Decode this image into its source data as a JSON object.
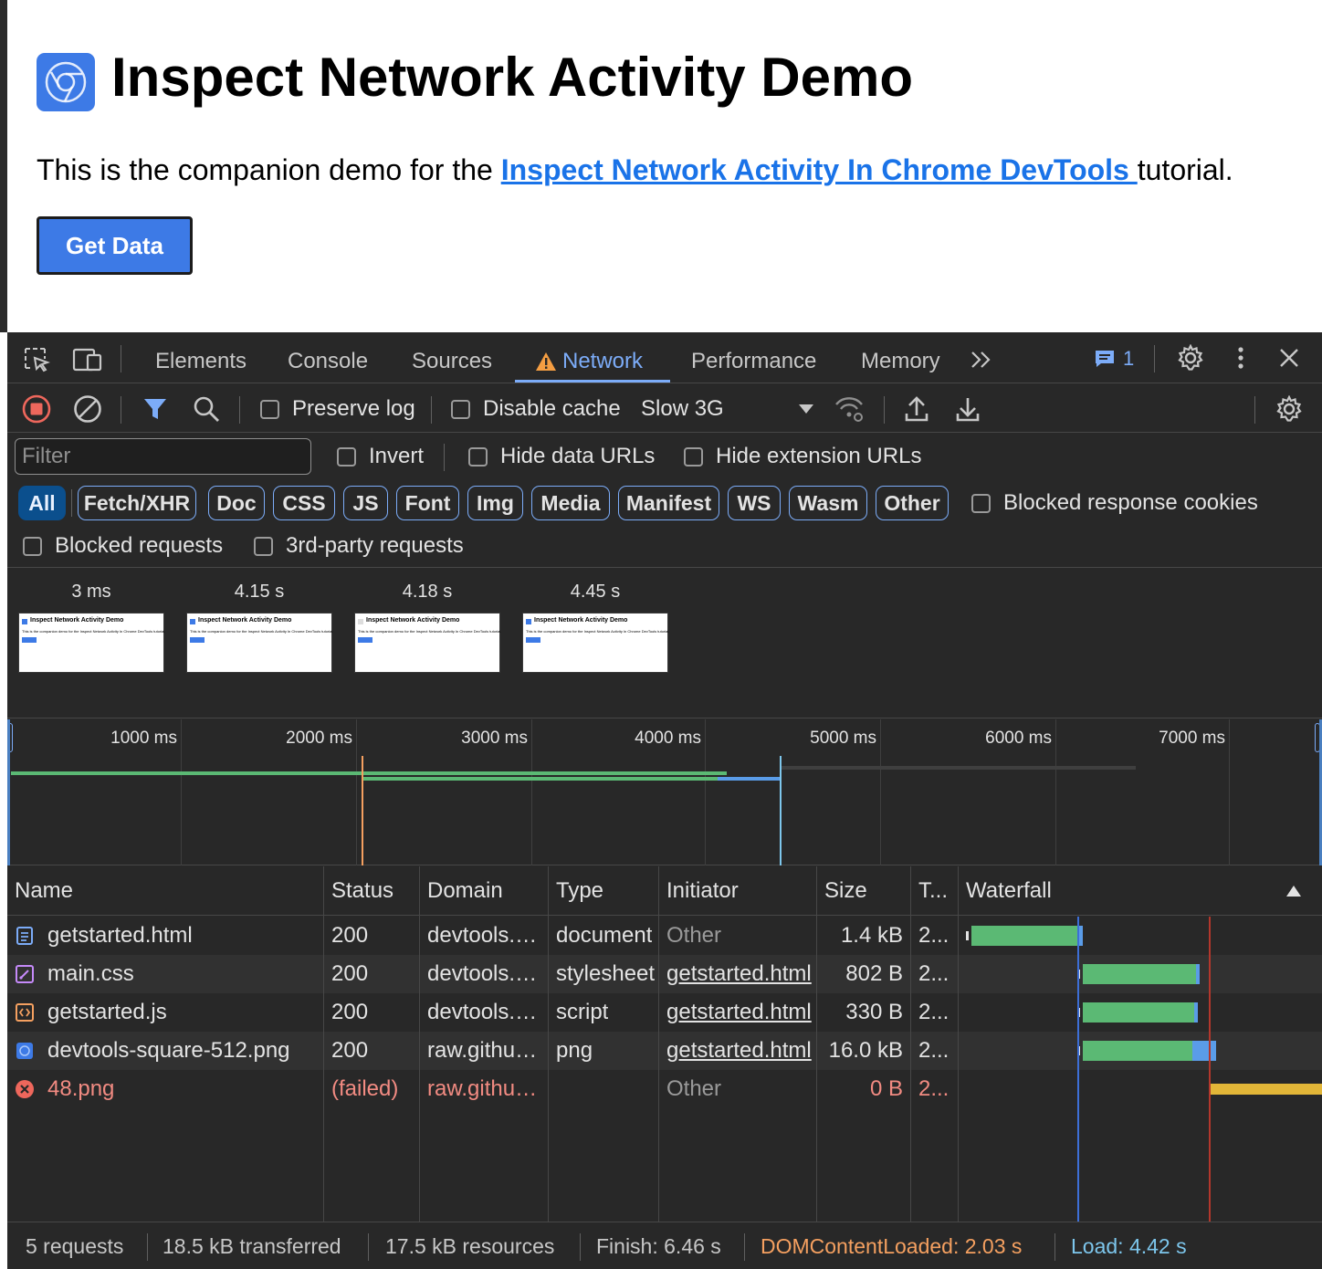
{
  "page": {
    "title": "Inspect Network Activity Demo",
    "text_before": "This is the companion demo for the ",
    "link_text": "Inspect Network Activity In Chrome DevTools ",
    "text_after": "tutorial.",
    "button_label": "Get Data"
  },
  "devtools": {
    "tabs": [
      "Elements",
      "Console",
      "Sources",
      "Network",
      "Performance",
      "Memory"
    ],
    "active_tab": "Network",
    "issues_count": "1",
    "toolbar": {
      "preserve_log": "Preserve log",
      "disable_cache": "Disable cache",
      "throttling": "Slow 3G"
    },
    "filter": {
      "placeholder": "Filter",
      "invert": "Invert",
      "hide_data_urls": "Hide data URLs",
      "hide_extension_urls": "Hide extension URLs",
      "types": [
        "All",
        "Fetch/XHR",
        "Doc",
        "CSS",
        "JS",
        "Font",
        "Img",
        "Media",
        "Manifest",
        "WS",
        "Wasm",
        "Other"
      ],
      "active_type": "All",
      "blocked_response_cookies": "Blocked response cookies",
      "blocked_requests": "Blocked requests",
      "third_party_requests": "3rd-party requests"
    },
    "screenshots": [
      {
        "time": "3 ms"
      },
      {
        "time": "4.15 s"
      },
      {
        "time": "4.18 s"
      },
      {
        "time": "4.45 s"
      }
    ],
    "screenshot_thumb": {
      "title": "Inspect Network Activity Demo",
      "text": "This is the companion demo for the Inspect Network Activity In Chrome DevTools tutorial."
    },
    "overview_ticks": [
      "1000 ms",
      "2000 ms",
      "3000 ms",
      "4000 ms",
      "5000 ms",
      "6000 ms",
      "7000 ms"
    ],
    "columns": [
      "Name",
      "Status",
      "Domain",
      "Type",
      "Initiator",
      "Size",
      "T...",
      "Waterfall"
    ],
    "requests": [
      {
        "name": "getstarted.html",
        "icon": "document-icon",
        "status": "200",
        "domain": "devtools.glitch.me",
        "type": "document",
        "initiator": "Other",
        "size": "1.4 kB",
        "time": "2..."
      },
      {
        "name": "main.css",
        "icon": "stylesheet-icon",
        "status": "200",
        "domain": "devtools.glitch.me",
        "type": "stylesheet",
        "initiator": "getstarted.html",
        "size": "802 B",
        "time": "2..."
      },
      {
        "name": "getstarted.js",
        "icon": "script-icon",
        "status": "200",
        "domain": "devtools.glitch.me",
        "type": "script",
        "initiator": "getstarted.html",
        "size": "330 B",
        "time": "2..."
      },
      {
        "name": "devtools-square-512.png",
        "icon": "image-icon",
        "status": "200",
        "domain": "raw.githubusercontent.com",
        "type": "png",
        "initiator": "getstarted.html",
        "size": "16.0 kB",
        "time": "2..."
      },
      {
        "name": "48.png",
        "icon": "error-icon",
        "status": "(failed)",
        "domain": "raw.githubusercontent.com",
        "type": "",
        "initiator": "Other",
        "size": "0 B",
        "time": "2..."
      }
    ],
    "status_bar": {
      "requests": "5 requests",
      "transferred": "18.5 kB transferred",
      "resources": "17.5 kB resources",
      "finish": "Finish: 6.46 s",
      "dom_content_loaded": "DOMContentLoaded: 2.03 s",
      "load": "Load: 4.42 s"
    },
    "colors": {
      "accent": "#7cacf8",
      "dcl": "#f5a060",
      "load": "#7dc6ec",
      "waterfall_download": "#5bb974",
      "waterfall_waiting": "#5a9ce8",
      "waterfall_failed": "#e2b638"
    }
  }
}
